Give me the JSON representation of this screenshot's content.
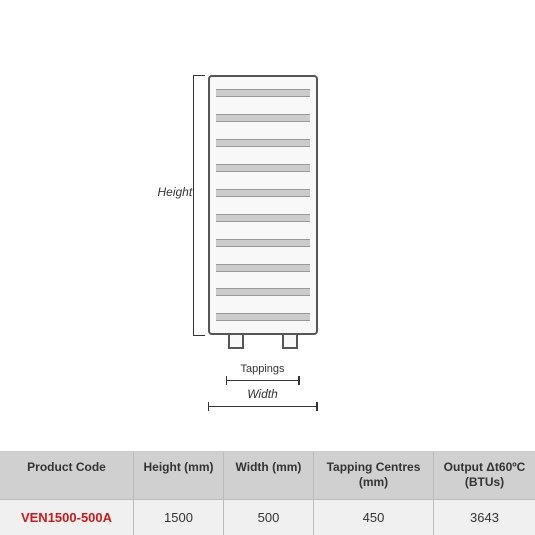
{
  "diagram": {
    "height_label": "Height",
    "tappings_label": "Tappings",
    "width_label": "Width"
  },
  "table": {
    "headers": {
      "product_code": "Product Code",
      "height_mm": "Height (mm)",
      "width_mm": "Width (mm)",
      "tapping_centres": "Tapping Centres (mm)",
      "output": "Output Δt60ºC (BTUs)"
    },
    "row": {
      "product_code": "VEN1500-500A",
      "height": "1500",
      "width": "500",
      "tapping_centres": "450",
      "output": "3643"
    }
  }
}
